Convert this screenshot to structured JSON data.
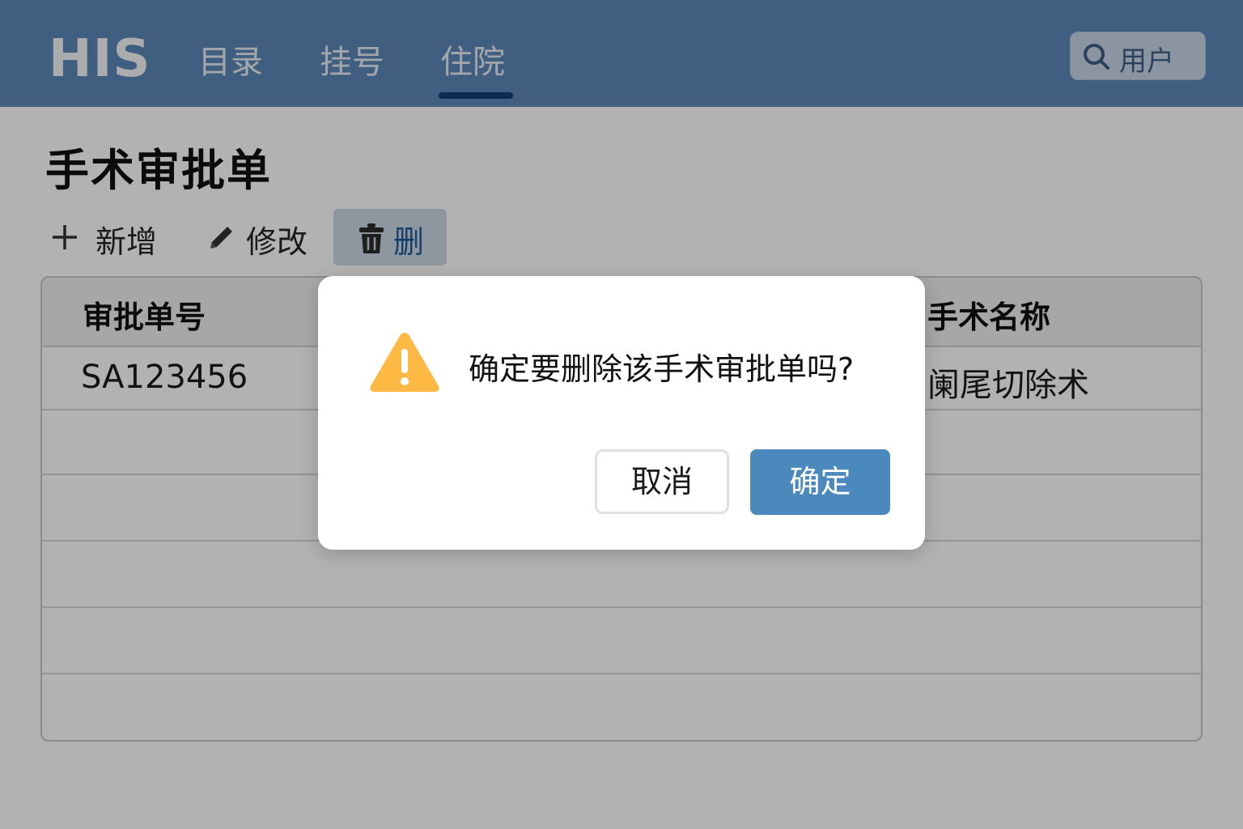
{
  "header": {
    "logo": "HIS",
    "tabs": [
      {
        "label": "目录"
      },
      {
        "label": "挂号"
      },
      {
        "label": "住院",
        "active": true
      }
    ],
    "user": {
      "label": "用户",
      "icon": "search-icon"
    }
  },
  "page": {
    "title": "手术审批单"
  },
  "toolbar": {
    "add_label": "新增",
    "edit_label": "修改",
    "delete_label": "删"
  },
  "table": {
    "columns": [
      "审批单号",
      "手术名称"
    ],
    "rows": [
      [
        "SA123456",
        "阑尾切除术"
      ]
    ]
  },
  "dialog": {
    "icon": "warning-icon",
    "message": "确定要删除该手术审批单吗?",
    "cancel_label": "取消",
    "confirm_label": "确定"
  },
  "colors": {
    "header_bg": "#5b87b8",
    "active_tab_underline": "#0e3f72",
    "primary_button": "#4b89bd",
    "warning": "#fdb944"
  }
}
